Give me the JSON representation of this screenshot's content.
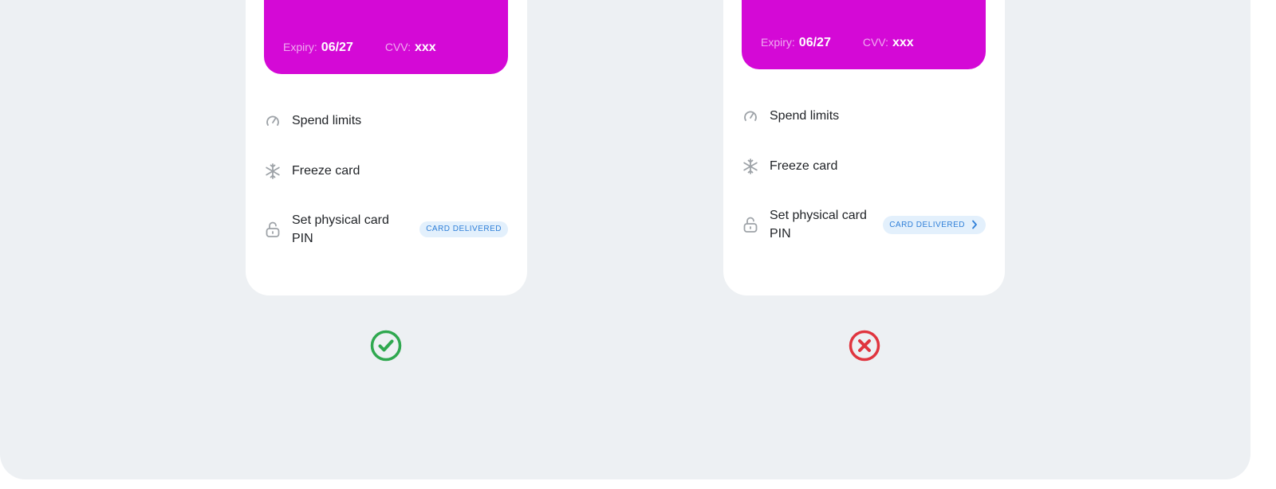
{
  "colors": {
    "background": "#edf0f3",
    "card": "#d409d6",
    "badge_bg": "#e3f0fc",
    "badge_text": "#2f7fd8",
    "success": "#2fa84f",
    "error": "#e0353f",
    "icon": "#9ea3a8"
  },
  "good_example": {
    "card": {
      "expiry_label": "Expiry:",
      "expiry_value": "06/27",
      "cvv_label": "CVV:",
      "cvv_value": "xxx"
    },
    "menu": [
      {
        "icon": "speedometer-icon",
        "label": "Spend limits"
      },
      {
        "icon": "snowflake-icon",
        "label": "Freeze card"
      },
      {
        "icon": "unlock-icon",
        "label": "Set physical card PIN",
        "badge": "CARD DELIVERED"
      }
    ],
    "verdict_icon": "check-circle-icon"
  },
  "bad_example": {
    "card": {
      "expiry_label": "Expiry:",
      "expiry_value": "06/27",
      "cvv_label": "CVV:",
      "cvv_value": "xxx"
    },
    "menu": [
      {
        "icon": "speedometer-icon",
        "label": "Spend limits"
      },
      {
        "icon": "snowflake-icon",
        "label": "Freeze card"
      },
      {
        "icon": "unlock-icon",
        "label": "Set physical card PIN",
        "badge": "CARD DELIVERED",
        "badge_icon": "chevron-right-icon"
      }
    ],
    "verdict_icon": "x-circle-icon"
  }
}
